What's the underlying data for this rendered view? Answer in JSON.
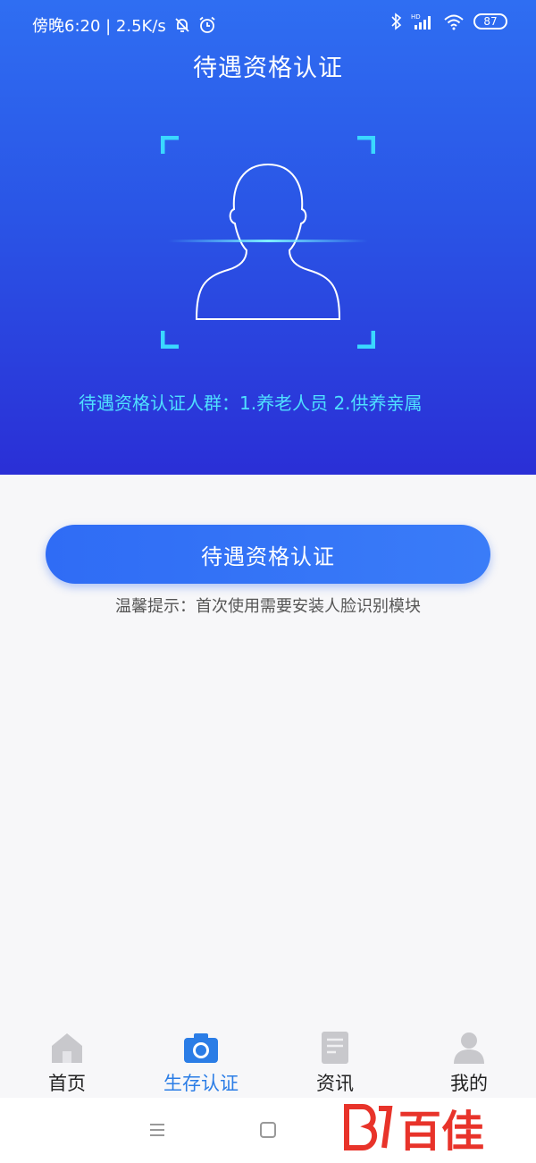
{
  "status_bar": {
    "time": "傍晚6:20 | 2.5K/s",
    "battery": "87",
    "network_label": "HD"
  },
  "header": {
    "title": "待遇资格认证"
  },
  "scan_info": "待遇资格认证人群：1.养老人员    2.供养亲属",
  "main": {
    "verify_button": "待遇资格认证",
    "hint": "温馨提示：首次使用需要安装人脸识别模块"
  },
  "tabbar": {
    "items": [
      {
        "label": "首页",
        "icon": "home-icon"
      },
      {
        "label": "生存认证",
        "icon": "camera-icon"
      },
      {
        "label": "资讯",
        "icon": "news-icon"
      },
      {
        "label": "我的",
        "icon": "user-icon"
      }
    ],
    "active_index": 1
  },
  "watermark": "百佳",
  "colors": {
    "primary": "#2f6ef2",
    "accent_cyan": "#4fe0ff",
    "tab_active": "#2b7de6",
    "tab_inactive": "#c8c8cc",
    "watermark": "#e8332a"
  }
}
